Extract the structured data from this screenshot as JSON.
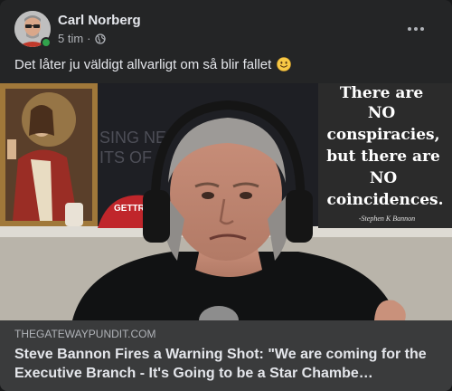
{
  "post": {
    "author": "Carl Norberg",
    "time": "5 tim",
    "separator": "·",
    "privacy_icon": "globe-icon",
    "more_icon": "more-options-icon",
    "text": "Det låter ju väldigt allvarligt om så blir fallet",
    "emoji": "slightly-smiling-face-emoji"
  },
  "media": {
    "background_sign": [
      "SING NE",
      "ITS OF"
    ],
    "sign_lines": [
      "There are",
      "NO",
      "conspiracies,",
      "but there are",
      "NO",
      "coincidences."
    ],
    "sign_signature": "-Stephen K Bannon",
    "cap_text": "GETTR"
  },
  "link_preview": {
    "domain": "THEGATEWAYPUNDIT.COM",
    "title": "Steve Bannon Fires a Warning Shot: \"We are coming for the Executive Branch - It's Going to be a Star Chambe…"
  },
  "colors": {
    "card": "#242526",
    "link_bg": "#3a3b3c",
    "text_primary": "#e4e6eb",
    "text_secondary": "#b0b3b8",
    "online": "#31a24c"
  }
}
